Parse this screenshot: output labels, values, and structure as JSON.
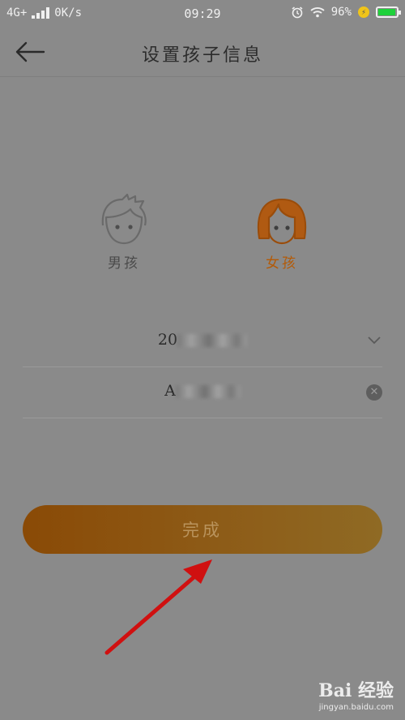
{
  "status_bar": {
    "network": "4G+",
    "speed": "0K/s",
    "time": "09:29",
    "battery_percent": "96%",
    "battery_level": 0.96
  },
  "header": {
    "title": "设置孩子信息",
    "back_icon": "arrow-left-icon"
  },
  "gender": {
    "boy_label": "男孩",
    "girl_label": "女孩",
    "selected": "girl",
    "selected_color": "#b45a06"
  },
  "form": {
    "birthday_prefix": "20",
    "name_prefix": "A"
  },
  "actions": {
    "done_label": "完成",
    "accent": "#8a4a06"
  },
  "watermark": {
    "brand": "Bai 经验",
    "site": "jingyan.baidu.com"
  }
}
